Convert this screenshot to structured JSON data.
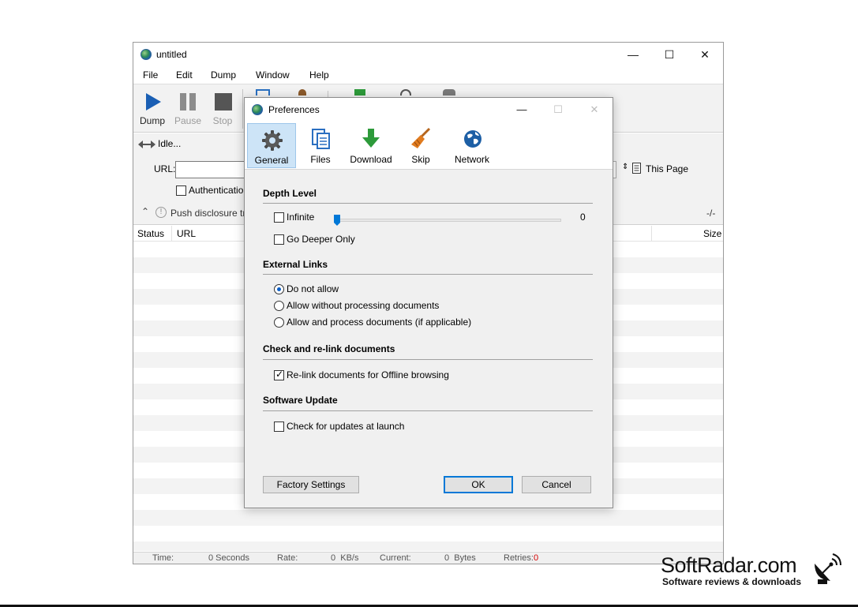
{
  "main_window": {
    "title": "untitled",
    "controls": {
      "minimize": "—",
      "maximize": "☐",
      "close": "✕"
    },
    "menu": [
      "File",
      "Edit",
      "Dump",
      "Window",
      "Help"
    ],
    "toolbar": {
      "dump": "Dump",
      "pause": "Pause",
      "stop": "Stop"
    },
    "status_text": "Idle...",
    "url_label": "URL:",
    "url_value": "",
    "scope_label": "This Page",
    "auth_label": "Authenticatio",
    "push_text": "Push disclosure tr",
    "progress_text": "-/-",
    "columns": {
      "status": "Status",
      "url": "URL",
      "size": "Size"
    },
    "statusbar": {
      "time_label": "Time:",
      "time_value": "0 Seconds",
      "rate_label": "Rate:",
      "rate_value": "0  KB/s",
      "current_label": "Current:",
      "current_value": "0  Bytes",
      "retries_label": "Retries:",
      "retries_value": "0"
    }
  },
  "preferences": {
    "title": "Preferences",
    "controls": {
      "minimize": "—",
      "maximize": "☐",
      "close": "✕"
    },
    "tabs": [
      {
        "label": "General",
        "icon": "gear-icon",
        "active": true
      },
      {
        "label": "Files",
        "icon": "files-icon",
        "active": false
      },
      {
        "label": "Download",
        "icon": "download-arrow-icon",
        "active": false
      },
      {
        "label": "Skip",
        "icon": "broom-icon",
        "active": false
      },
      {
        "label": "Network",
        "icon": "globe-icon",
        "active": false
      }
    ],
    "depth_level": {
      "title": "Depth Level",
      "infinite_label": "Infinite",
      "infinite_checked": false,
      "depth_value": "0",
      "go_deeper_label": "Go Deeper Only",
      "go_deeper_checked": false
    },
    "external_links": {
      "title": "External Links",
      "options": [
        {
          "label": "Do not allow",
          "checked": true
        },
        {
          "label": "Allow without processing documents",
          "checked": false
        },
        {
          "label": "Allow and process documents (if applicable)",
          "checked": false
        }
      ]
    },
    "relink": {
      "title": "Check and re-link documents",
      "label": "Re-link documents for Offline browsing",
      "checked": true
    },
    "software_update": {
      "title": "Software Update",
      "label": "Check for updates at launch",
      "checked": false
    },
    "buttons": {
      "factory": "Factory Settings",
      "ok": "OK",
      "cancel": "Cancel"
    }
  },
  "watermark": {
    "brand": "SoftRadar.com",
    "tagline": "Software reviews & downloads"
  },
  "colors": {
    "accent": "#0078d7",
    "active_tab": "#cde4f7",
    "retries_value": "#d40000",
    "dialog_bg": "#f0f0f0"
  }
}
